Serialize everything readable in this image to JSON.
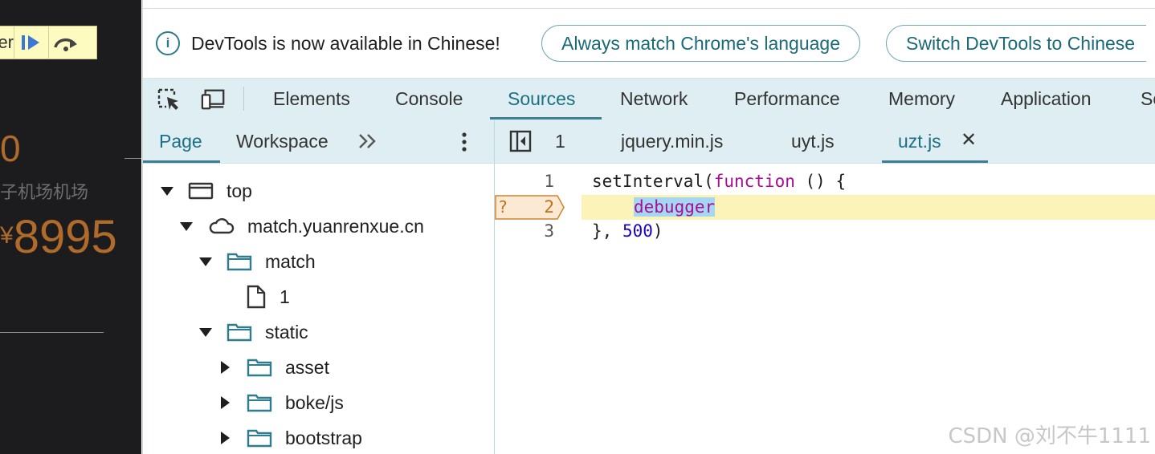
{
  "page": {
    "paused_text": "er",
    "frag_zero": "0",
    "frag_chinese": "子机场机场",
    "frag_currency": "¥",
    "frag_price": "8995"
  },
  "infobar": {
    "message": "DevTools is now available in Chinese!",
    "btn_match": "Always match Chrome's language",
    "btn_switch": "Switch DevTools to Chinese"
  },
  "main_tabs": [
    "Elements",
    "Console",
    "Sources",
    "Network",
    "Performance",
    "Memory",
    "Application",
    "So"
  ],
  "active_main_tab": "Sources",
  "navigator": {
    "tabs": [
      "Page",
      "Workspace"
    ],
    "tree": [
      {
        "label": "top",
        "icon": "frame-icon",
        "expanded": true
      },
      {
        "label": "match.yuanrenxue.cn",
        "icon": "cloud-icon",
        "expanded": true
      },
      {
        "label": "match",
        "icon": "folder-icon",
        "expanded": true
      },
      {
        "label": "1",
        "icon": "file-icon"
      },
      {
        "label": "static",
        "icon": "folder-icon",
        "expanded": true
      },
      {
        "label": "asset",
        "icon": "folder-icon",
        "expanded": false
      },
      {
        "label": "boke/js",
        "icon": "folder-icon",
        "expanded": false
      },
      {
        "label": "bootstrap",
        "icon": "folder-icon",
        "expanded": false
      }
    ]
  },
  "editor": {
    "tabs": [
      "1",
      "jquery.min.js",
      "uyt.js",
      "uzt.js"
    ],
    "active_tab": "uzt.js",
    "lines": [
      {
        "n": "1",
        "p1": "setInterval(",
        "kw": "function",
        "p2": " () {"
      },
      {
        "n": "2",
        "hl": "debugger"
      },
      {
        "n": "3",
        "p1": "}, ",
        "num": "500",
        "p2": ")"
      }
    ],
    "breakpoint_marker": "?"
  },
  "watermark": "CSDN @刘不牛1111",
  "colors": {
    "accent": "#1d6f84",
    "toolbar_bg": "#dfeef2",
    "highlight_line": "#fcf3b8"
  }
}
